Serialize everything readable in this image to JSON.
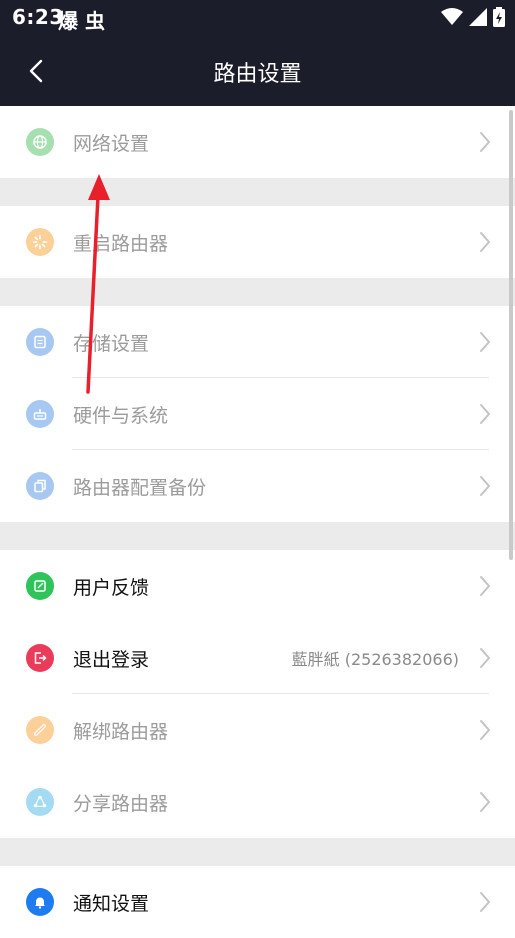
{
  "status_bar": {
    "time": "6:23",
    "notifications": "爆 虫"
  },
  "header": {
    "title": "路由设置"
  },
  "groups": [
    {
      "items": [
        {
          "label": "网络设置",
          "icon": "globe-icon",
          "color": "#a6dfb0",
          "enabled": false
        }
      ]
    },
    {
      "items": [
        {
          "label": "重启路由器",
          "icon": "restart-icon",
          "color": "#fbd199",
          "enabled": false
        }
      ]
    },
    {
      "items": [
        {
          "label": "存储设置",
          "icon": "storage-icon",
          "color": "#a7c9f1",
          "enabled": false
        },
        {
          "label": "硬件与系统",
          "icon": "hardware-icon",
          "color": "#a7c9f1",
          "enabled": false
        },
        {
          "label": "路由器配置备份",
          "icon": "backup-icon",
          "color": "#a7c9f1",
          "enabled": false
        }
      ]
    },
    {
      "items": [
        {
          "label": "用户反馈",
          "icon": "feedback-icon",
          "color": "#2ec45a",
          "enabled": true
        },
        {
          "label": "退出登录",
          "icon": "logout-icon",
          "color": "#ea3b5b",
          "enabled": true,
          "value": "藍胖紙 (2526382066)"
        },
        {
          "label": "解绑路由器",
          "icon": "unbind-icon",
          "color": "#fbd199",
          "enabled": false
        },
        {
          "label": "分享路由器",
          "icon": "share-icon",
          "color": "#a4dbf2",
          "enabled": false
        }
      ]
    },
    {
      "items": [
        {
          "label": "通知设置",
          "icon": "bell-icon",
          "color": "#1f7cf0",
          "enabled": true
        }
      ]
    }
  ],
  "colors": {
    "header_bg": "#1c1d2b",
    "annotation_arrow": "#e8202c"
  }
}
